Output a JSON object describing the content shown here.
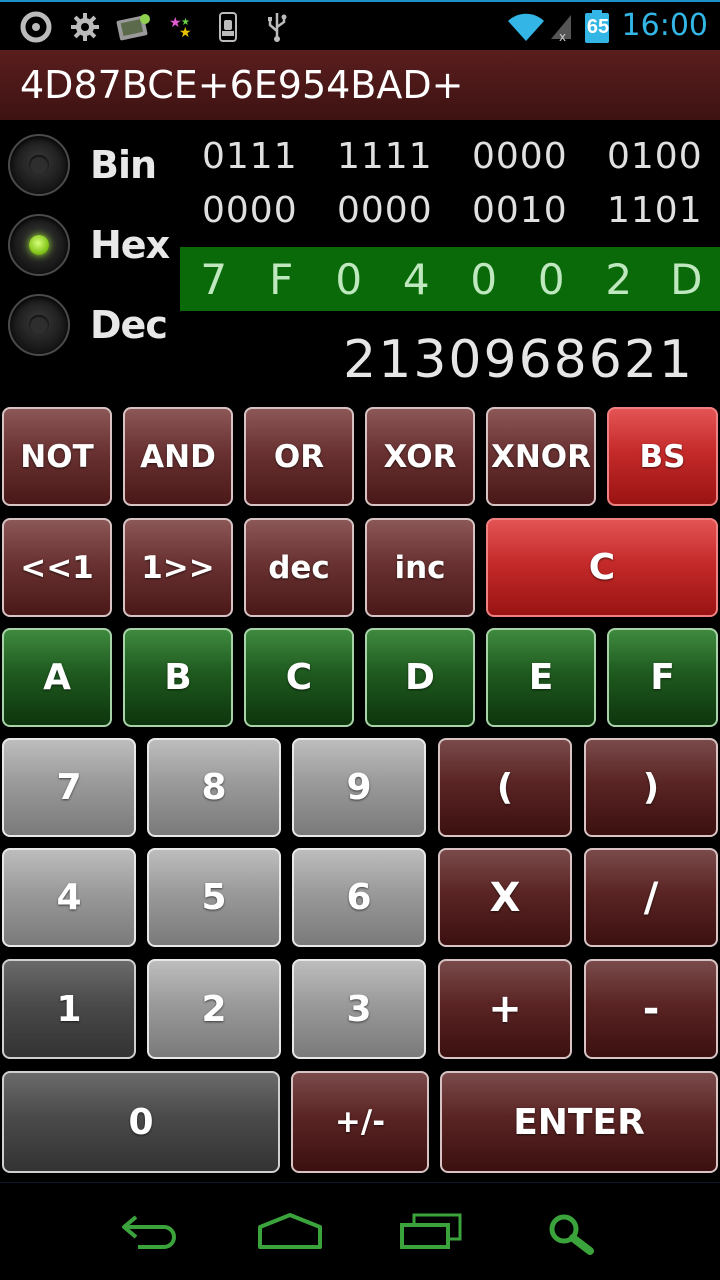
{
  "status_bar": {
    "time": "16:00",
    "battery": "65",
    "icons": [
      "circle-app-icon",
      "gear-icon",
      "photo-icon",
      "stars-icon",
      "android-debug-icon",
      "usb-icon",
      "wifi-icon",
      "no-signal-icon",
      "battery-icon"
    ]
  },
  "expression": "4D87BCE+6E954BAD+",
  "modes": [
    {
      "label": "Bin",
      "selected": false
    },
    {
      "label": "Hex",
      "selected": true
    },
    {
      "label": "Dec",
      "selected": false
    }
  ],
  "display": {
    "bin_row1": [
      "0111",
      "1111",
      "0000",
      "0100"
    ],
    "bin_row2": [
      "0000",
      "0000",
      "0010",
      "1101"
    ],
    "hex_digits": [
      "7",
      "F",
      "0",
      "4",
      "0",
      "0",
      "2",
      "D"
    ],
    "dec_value": "2130968621"
  },
  "keys": {
    "not": "NOT",
    "and": "AND",
    "or": "OR",
    "xor": "XOR",
    "xnor": "XNOR",
    "bs": "BS",
    "shl": "<<1",
    "shr": "1>>",
    "dec": "dec",
    "inc": "inc",
    "clear": "C",
    "a": "A",
    "b": "B",
    "c": "C",
    "d": "D",
    "e": "E",
    "f": "F",
    "n7": "7",
    "n8": "8",
    "n9": "9",
    "lparen": "(",
    "rparen": ")",
    "n4": "4",
    "n5": "5",
    "n6": "6",
    "mul": "X",
    "div": "/",
    "n1": "1",
    "n2": "2",
    "n3": "3",
    "plus": "+",
    "minus": "-",
    "n0": "0",
    "neg": "+/-",
    "enter": "ENTER"
  },
  "nav_icons": [
    "back-icon",
    "home-icon",
    "recents-icon",
    "search-icon"
  ],
  "colors": {
    "accent": "#33b5e5",
    "hex_bar": "#0a6a0a",
    "expression_bg": "#4a1818"
  }
}
